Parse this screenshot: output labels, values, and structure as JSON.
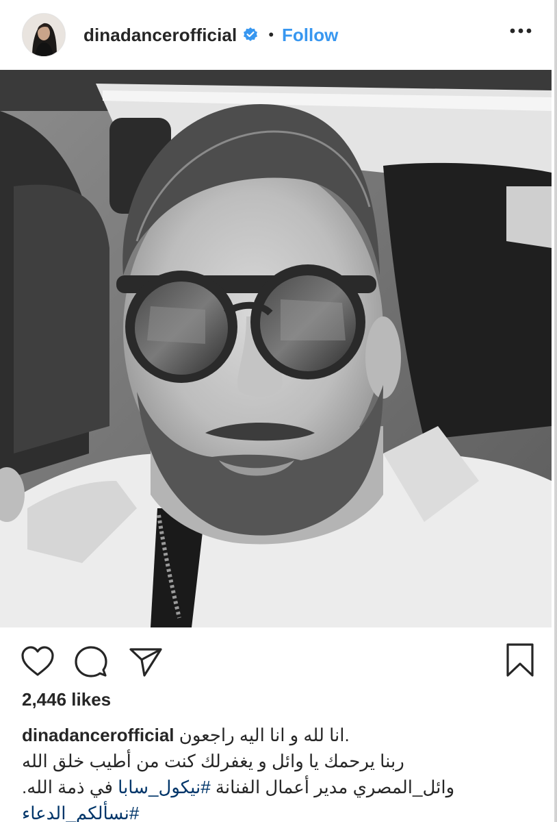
{
  "header": {
    "username": "dinadancerofficial",
    "separator": "•",
    "follow_label": "Follow",
    "accent_color": "#3897f0",
    "verified_icon": "verified-badge-icon",
    "more_icon": "more-options-icon"
  },
  "post": {
    "image_alt": "Black and white selfie of a bearded man wearing round sunglasses and a white shirt inside a car",
    "actions": {
      "like_icon": "heart-icon",
      "comment_icon": "comment-icon",
      "share_icon": "share-icon",
      "save_icon": "bookmark-icon"
    },
    "likes": "2,446 likes",
    "caption": {
      "username": "dinadancerofficial",
      "line1_text": ".انا لله و انا اليه راجعون",
      "line2_text": "ربنا يرحمك يا وائل و يغفرلك كنت من أطيب خلق الله",
      "line3_prefix": "وائل_المصري مدير أعمال الفنانة ",
      "line3_hashtag": "#نيكول_سابا",
      "line3_suffix": " في ذمة الله.",
      "line4_hashtag": "#نسألكم_الدعاء"
    }
  }
}
